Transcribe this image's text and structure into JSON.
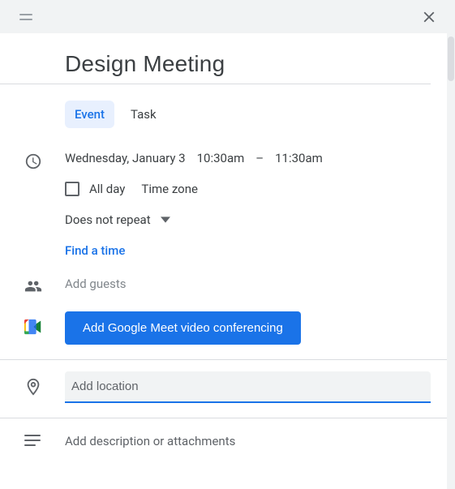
{
  "title": "Design Meeting",
  "tabs": {
    "event": "Event",
    "task": "Task"
  },
  "date": {
    "day": "Wednesday, January 3",
    "start": "10:30am",
    "sep": "–",
    "end": "11:30am"
  },
  "allday": "All day",
  "timezone": "Time zone",
  "repeat": "Does not repeat",
  "findtime": "Find a time",
  "guests_placeholder": "Add guests",
  "meet_button": "Add Google Meet video conferencing",
  "location_placeholder": "Add location",
  "description_placeholder": "Add description or attachments"
}
